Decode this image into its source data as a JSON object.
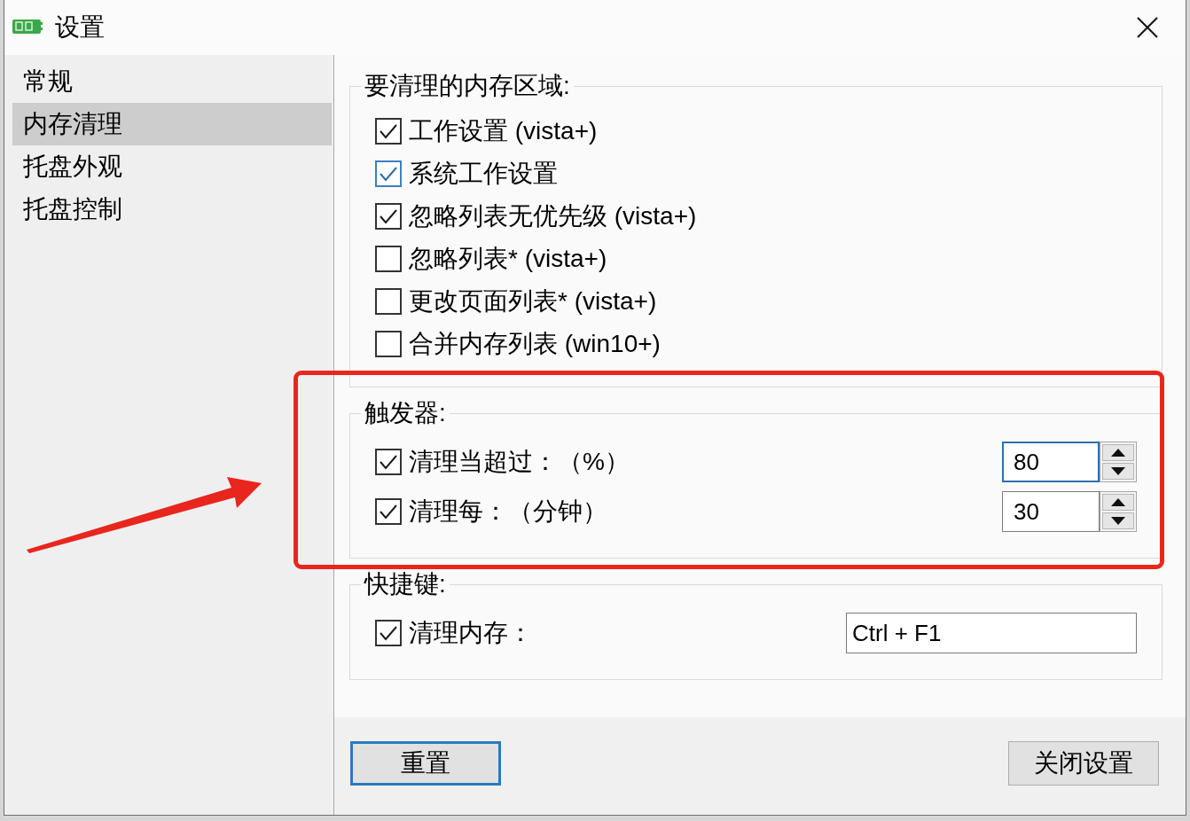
{
  "window": {
    "title": "设置"
  },
  "sidebar": {
    "items": [
      {
        "label": "常规",
        "selected": false
      },
      {
        "label": "内存清理",
        "selected": true
      },
      {
        "label": "托盘外观",
        "selected": false
      },
      {
        "label": "托盘控制",
        "selected": false
      }
    ]
  },
  "groups": [
    {
      "title": "要清理的内存区域:",
      "highlighted": false,
      "items": [
        {
          "kind": "checkbox",
          "label": "工作设置 (vista+)",
          "checked": true,
          "hovered": false
        },
        {
          "kind": "checkbox",
          "label": "系统工作设置",
          "checked": true,
          "hovered": true
        },
        {
          "kind": "checkbox",
          "label": "忽略列表无优先级 (vista+)",
          "checked": true,
          "hovered": false
        },
        {
          "kind": "checkbox",
          "label": "忽略列表* (vista+)",
          "checked": false,
          "hovered": false
        },
        {
          "kind": "checkbox",
          "label": "更改页面列表* (vista+)",
          "checked": false,
          "hovered": false
        },
        {
          "kind": "checkbox",
          "label": "合并内存列表 (win10+)",
          "checked": false,
          "hovered": false
        }
      ]
    },
    {
      "title": "触发器:",
      "highlighted": true,
      "items": [
        {
          "kind": "spin",
          "label": "清理当超过：（%）",
          "checked": true,
          "value": "80",
          "focused": true
        },
        {
          "kind": "spin",
          "label": "清理每：（分钟）",
          "checked": true,
          "value": "30",
          "focused": false
        }
      ]
    },
    {
      "title": "快捷键:",
      "highlighted": false,
      "items": [
        {
          "kind": "hotkey",
          "label": "清理内存：",
          "checked": true,
          "value": "Ctrl + F1"
        }
      ]
    }
  ],
  "buttons": [
    {
      "label": "重置",
      "default": true
    },
    {
      "label": "关闭设置",
      "default": false
    }
  ]
}
